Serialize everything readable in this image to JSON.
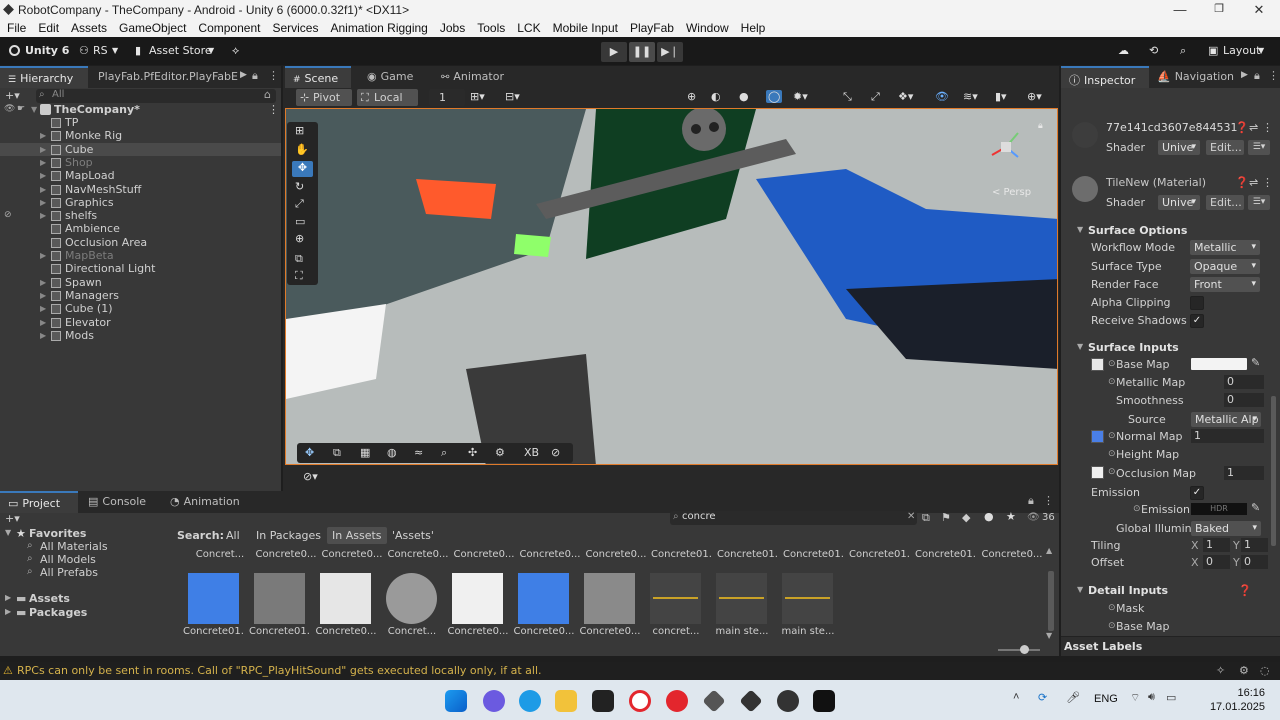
{
  "window": {
    "title": "RobotCompany - TheCompany - Android - Unity 6 (6000.0.32f1)* <DX11>",
    "minimize": "—",
    "maximize": "❐",
    "close": "✕"
  },
  "menu": [
    "File",
    "Edit",
    "Assets",
    "GameObject",
    "Component",
    "Services",
    "Animation Rigging",
    "Jobs",
    "Tools",
    "LCK",
    "Mobile Input",
    "PlayFab",
    "Window",
    "Help"
  ],
  "toolbar": {
    "unity_label": "Unity 6",
    "account": "RS",
    "asset_store": "Asset Store",
    "layout": "Layout"
  },
  "hierarchy": {
    "tabs": [
      "Hierarchy",
      "PlayFab.PfEditor.PlayFabEdit"
    ],
    "search_placeholder": "All",
    "scene_name": "TheCompany*",
    "items": [
      {
        "label": "TP",
        "expand": false,
        "dim": false,
        "sel": false
      },
      {
        "label": "Monke Rig",
        "expand": true,
        "dim": false,
        "sel": false
      },
      {
        "label": "Cube",
        "expand": true,
        "dim": false,
        "sel": true
      },
      {
        "label": "Shop",
        "expand": true,
        "dim": true,
        "sel": false
      },
      {
        "label": "MapLoad",
        "expand": true,
        "dim": false,
        "sel": false
      },
      {
        "label": "NavMeshStuff",
        "expand": true,
        "dim": false,
        "sel": false
      },
      {
        "label": "Graphics",
        "expand": true,
        "dim": false,
        "sel": false
      },
      {
        "label": "shelfs",
        "expand": true,
        "dim": false,
        "sel": false
      },
      {
        "label": "Ambience",
        "expand": false,
        "dim": false,
        "sel": false
      },
      {
        "label": "Occlusion Area",
        "expand": false,
        "dim": false,
        "sel": false
      },
      {
        "label": "MapBeta",
        "expand": true,
        "dim": true,
        "sel": false
      },
      {
        "label": "Directional Light",
        "expand": false,
        "dim": false,
        "sel": false
      },
      {
        "label": "Spawn",
        "expand": true,
        "dim": false,
        "sel": false
      },
      {
        "label": "Managers",
        "expand": true,
        "dim": false,
        "sel": false
      },
      {
        "label": "Cube (1)",
        "expand": true,
        "dim": false,
        "sel": false
      },
      {
        "label": "Elevator",
        "expand": true,
        "dim": false,
        "sel": false
      },
      {
        "label": "Mods",
        "expand": true,
        "dim": false,
        "sel": false
      }
    ]
  },
  "scene": {
    "tabs": [
      "Scene",
      "Game",
      "Animator"
    ],
    "pivot": "Pivot",
    "local": "Local",
    "snap_value": "1",
    "persp_label": "< Persp",
    "xb_label": "XB"
  },
  "inspector": {
    "tabs": [
      "Inspector",
      "Navigation"
    ],
    "material1_name": "77e141cd3607e844531",
    "material2_name": "TileNew (Material)",
    "shader_label": "Shader",
    "shader_value": "Unive",
    "edit_label": "Edit...",
    "surface_options": "Surface Options",
    "workflow_mode": {
      "label": "Workflow Mode",
      "value": "Metallic"
    },
    "surface_type": {
      "label": "Surface Type",
      "value": "Opaque"
    },
    "render_face": {
      "label": "Render Face",
      "value": "Front"
    },
    "alpha_clipping": "Alpha Clipping",
    "receive_shadows": "Receive Shadows",
    "surface_inputs": "Surface Inputs",
    "base_map": "Base Map",
    "metallic_map": {
      "label": "Metallic Map",
      "value": "0"
    },
    "smoothness": {
      "label": "Smoothness",
      "value": "0"
    },
    "source": {
      "label": "Source",
      "value": "Metallic Alp"
    },
    "normal_map": {
      "label": "Normal Map",
      "value": "1"
    },
    "height_map": "Height Map",
    "occlusion_map": {
      "label": "Occlusion Map",
      "value": "1"
    },
    "emission": "Emission",
    "emission_map": "Emission M",
    "hdr": "HDR",
    "global_illum": {
      "label": "Global Illuminat",
      "value": "Baked"
    },
    "tiling": {
      "label": "Tiling",
      "x": "1",
      "y": "1"
    },
    "offset": {
      "label": "Offset",
      "x": "0",
      "y": "0"
    },
    "detail_inputs": "Detail Inputs",
    "mask": "Mask",
    "detail_base_map": "Base Map",
    "asset_labels": "Asset Labels",
    "check": "✓"
  },
  "project": {
    "tabs": [
      "Project",
      "Console",
      "Animation"
    ],
    "favorites": "Favorites",
    "fav_items": [
      "All Materials",
      "All Models",
      "All Prefabs"
    ],
    "assets": "Assets",
    "packages": "Packages",
    "search_label": "Search:",
    "filters": [
      "All",
      "In Packages",
      "In Assets",
      "'Assets'"
    ],
    "search_value": "concre",
    "count": "36",
    "top_labels": [
      "Concret...",
      "Concrete0...",
      "Concrete0...",
      "Concrete0...",
      "Concrete0...",
      "Concrete0...",
      "Concrete0...",
      "Concrete01...",
      "Concrete01...",
      "Concrete01...",
      "Concrete01...",
      "Concrete01...",
      "Concrete0..."
    ],
    "thumbs": [
      {
        "label": "Concrete01...",
        "color": "#3f7fe6"
      },
      {
        "label": "Concrete01...",
        "color": "#7a7a7a"
      },
      {
        "label": "Concrete0...",
        "color": "#e6e6e6"
      },
      {
        "label": "Concret...",
        "color": "#9a9a9a"
      },
      {
        "label": "Concrete0...",
        "color": "#f0f0f0"
      },
      {
        "label": "Concrete0...",
        "color": "#3f7fe6"
      },
      {
        "label": "Concrete0...",
        "color": "#8a8a8a"
      },
      {
        "label": "concret...",
        "color": "#444444"
      },
      {
        "label": "main ste...",
        "color": "#444444"
      },
      {
        "label": "main ste...",
        "color": "#444444"
      }
    ]
  },
  "status": {
    "message": "RPCs can only be sent in rooms. Call of \"RPC_PlayHitSound\" gets executed locally only, if at all."
  },
  "taskbar": {
    "lang": "ENG",
    "time": "16:16",
    "date": "17.01.2025"
  }
}
